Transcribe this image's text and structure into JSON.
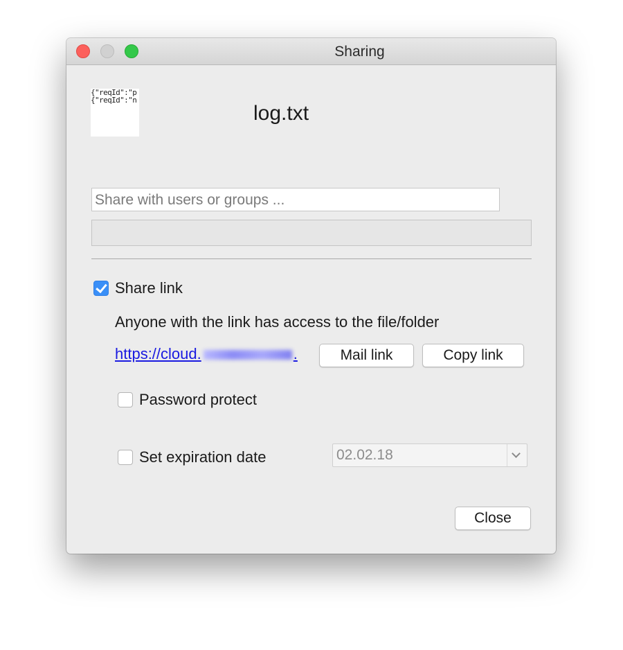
{
  "window": {
    "title": "Sharing"
  },
  "file": {
    "thumbnail_lines": [
      "{\"reqId\":\"p",
      "{\"reqId\":\"n"
    ],
    "name": "log.txt"
  },
  "share_input": {
    "placeholder": "Share with users or groups ...",
    "value": ""
  },
  "share_link": {
    "checkbox_label": "Share link",
    "checked": true,
    "description": "Anyone with the link has access to the file/folder",
    "url_prefix": "https://cloud.",
    "url_suffix": ".",
    "mail_link_label": "Mail link",
    "copy_link_label": "Copy link"
  },
  "password": {
    "label": "Password protect",
    "checked": false
  },
  "expiration": {
    "label": "Set expiration date",
    "checked": false,
    "date_value": "02.02.18"
  },
  "footer": {
    "close_label": "Close"
  },
  "colors": {
    "accent": "#3a8ff7",
    "link": "#1a1ae0",
    "traffic_close": "#fc605c",
    "traffic_max": "#34c84a"
  },
  "icons": [
    "checkmark-icon",
    "chevron-down-icon"
  ]
}
